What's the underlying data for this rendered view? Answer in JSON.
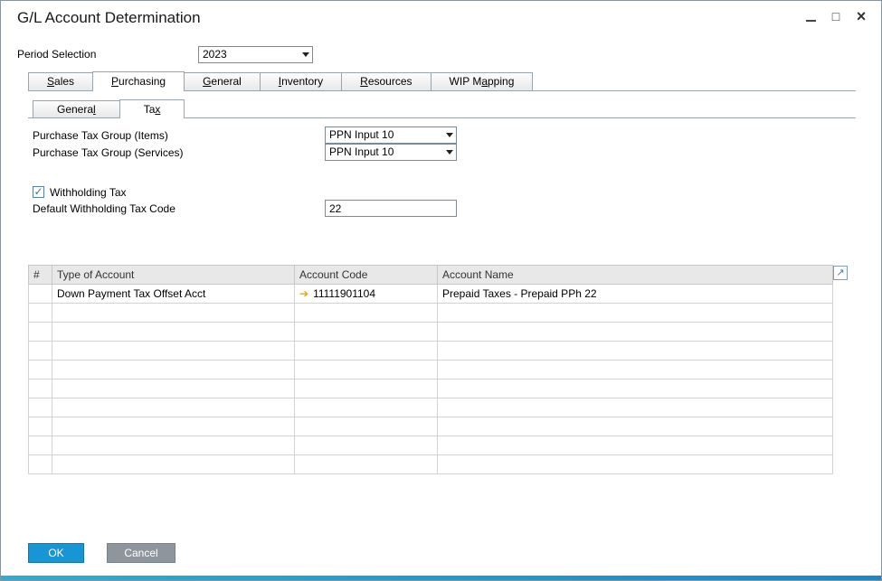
{
  "window": {
    "title": "G/L Account Determination"
  },
  "icons": {
    "maximize": "□",
    "close": "×",
    "link_arrow": "➔",
    "expand": "↗",
    "check": "✓"
  },
  "period": {
    "label": "Period Selection",
    "value": "2023"
  },
  "main_tabs": {
    "active_index": 1,
    "items": [
      {
        "pre": "",
        "key": "S",
        "post": "ales"
      },
      {
        "pre": "",
        "key": "P",
        "post": "urchasing"
      },
      {
        "pre": "",
        "key": "G",
        "post": "eneral"
      },
      {
        "pre": "",
        "key": "I",
        "post": "nventory"
      },
      {
        "pre": "",
        "key": "R",
        "post": "esources"
      },
      {
        "pre": "WIP M",
        "key": "a",
        "post": "pping"
      }
    ]
  },
  "sub_tabs": {
    "active_index": 1,
    "items": [
      {
        "pre": "Genera",
        "key": "l",
        "post": ""
      },
      {
        "pre": "Ta",
        "key": "x",
        "post": ""
      }
    ]
  },
  "form": {
    "tax_items_label": "Purchase Tax Group (Items)",
    "tax_items_value": "PPN Input 10",
    "tax_services_label": "Purchase Tax Group (Services)",
    "tax_services_value": "PPN Input 10",
    "withholding_label": "Withholding Tax",
    "withholding_checked": true,
    "default_code_label": "Default Withholding Tax Code",
    "default_code_value": "22"
  },
  "table": {
    "columns": [
      "#",
      "Type of Account",
      "Account Code",
      "Account Name"
    ],
    "total_rows": 10,
    "rows": [
      {
        "num": "",
        "type": "Down Payment Tax Offset Acct",
        "code": "11111901104",
        "name": "Prepaid Taxes - Prepaid PPh 22",
        "link": true
      }
    ]
  },
  "buttons": {
    "ok": "OK",
    "cancel": "Cancel"
  }
}
